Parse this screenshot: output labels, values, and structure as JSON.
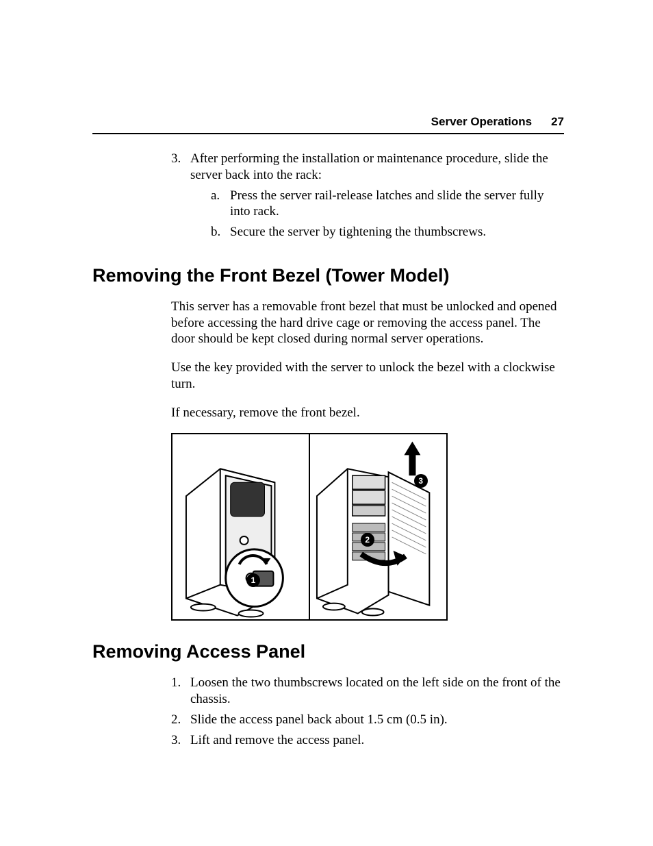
{
  "header": {
    "section": "Server Operations",
    "page": "27"
  },
  "continued_list": {
    "start": 3,
    "items": [
      {
        "num": "3.",
        "text": "After performing the installation or maintenance procedure, slide the server back into the rack:",
        "sub": [
          {
            "num": "a.",
            "text": "Press the server rail-release latches and slide the server fully into rack."
          },
          {
            "num": "b.",
            "text": "Secure the server by tightening the thumbscrews."
          }
        ]
      }
    ]
  },
  "sections": [
    {
      "heading": "Removing the Front Bezel (Tower Model)",
      "paragraphs": [
        "This server has a removable front bezel that must be unlocked and opened before accessing the hard drive cage or removing the access panel. The door should be kept closed during normal server operations.",
        "Use the key provided with the server to unlock the bezel with a clockwise turn.",
        "If necessary, remove the front bezel."
      ],
      "figure": {
        "type": "two-panel-illustration",
        "description": "Tower server: unlock bezel with key, swing open and lift off.",
        "callouts": [
          "1",
          "2",
          "3"
        ]
      }
    },
    {
      "heading": "Removing Access Panel",
      "ordered_list": [
        {
          "num": "1.",
          "text": "Loosen the two thumbscrews located on the left side on the front of the chassis."
        },
        {
          "num": "2.",
          "text": "Slide the access panel back about 1.5 cm (0.5 in)."
        },
        {
          "num": "3.",
          "text": "Lift and remove the access panel."
        }
      ]
    }
  ]
}
